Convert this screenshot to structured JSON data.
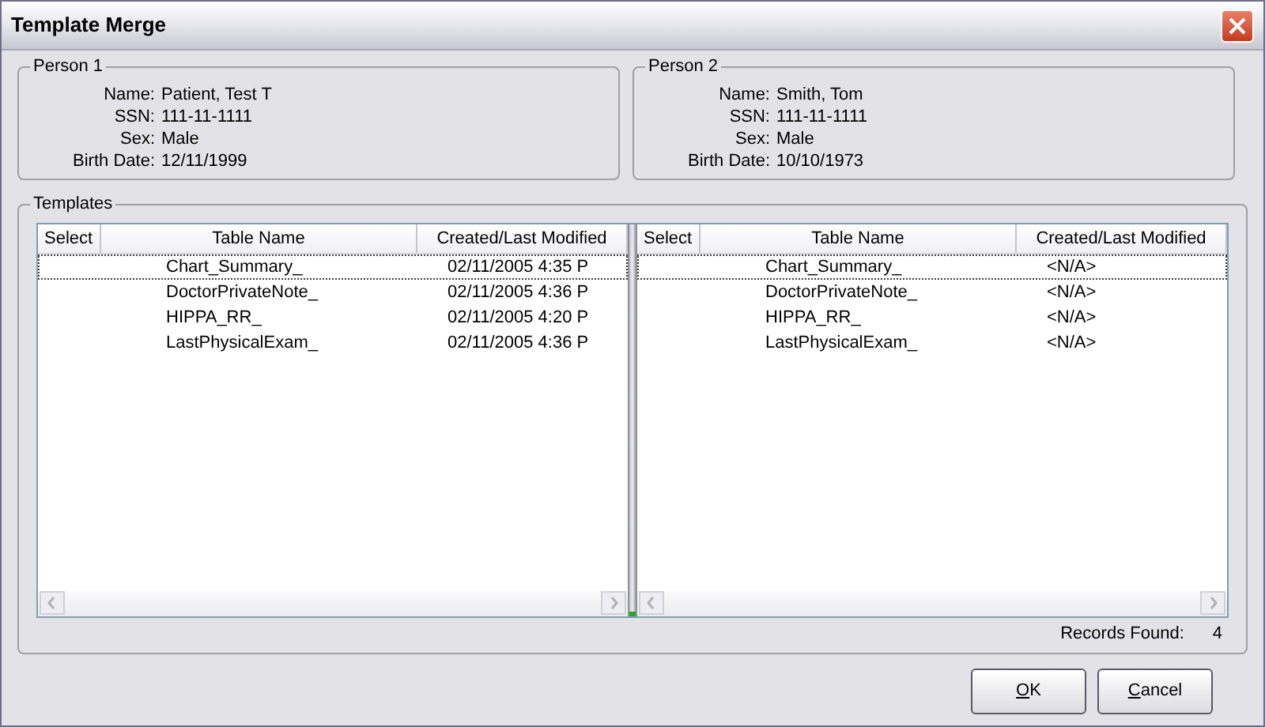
{
  "window": {
    "title": "Template Merge"
  },
  "persons": [
    {
      "title": "Person 1",
      "fields": [
        {
          "label": "Name:",
          "value": "Patient, Test T"
        },
        {
          "label": "SSN:",
          "value": "111-11-1111"
        },
        {
          "label": "Sex:",
          "value": "Male"
        },
        {
          "label": "Birth Date:",
          "value": "12/11/1999"
        }
      ]
    },
    {
      "title": "Person 2",
      "fields": [
        {
          "label": "Name:",
          "value": "Smith, Tom"
        },
        {
          "label": "SSN:",
          "value": "111-11-1111"
        },
        {
          "label": "Sex:",
          "value": "Male"
        },
        {
          "label": "Birth Date:",
          "value": "10/10/1973"
        }
      ]
    }
  ],
  "templates": {
    "title": "Templates",
    "tables": [
      {
        "columns": [
          "Select",
          "Table Name",
          "Created/Last Modified"
        ],
        "rows": [
          {
            "cells": [
              "",
              "Chart_Summary_",
              "02/11/2005 4:35 P"
            ],
            "focused": true
          },
          {
            "cells": [
              "",
              "DoctorPrivateNote_",
              "02/11/2005 4:36 P"
            ],
            "focused": false
          },
          {
            "cells": [
              "",
              "HIPPA_RR_",
              "02/11/2005 4:20 P"
            ],
            "focused": false
          },
          {
            "cells": [
              "",
              "LastPhysicalExam_",
              "02/11/2005 4:36 P"
            ],
            "focused": false
          }
        ]
      },
      {
        "columns": [
          "Select",
          "Table Name",
          "Created/Last Modified"
        ],
        "rows": [
          {
            "cells": [
              "",
              "Chart_Summary_",
              "<N/A>"
            ],
            "focused": true
          },
          {
            "cells": [
              "",
              "DoctorPrivateNote_",
              "<N/A>"
            ],
            "focused": false
          },
          {
            "cells": [
              "",
              "HIPPA_RR_",
              "<N/A>"
            ],
            "focused": false
          },
          {
            "cells": [
              "",
              "LastPhysicalExam_",
              "<N/A>"
            ],
            "focused": false
          }
        ]
      }
    ],
    "records_label": "Records Found:",
    "records_count": "4"
  },
  "buttons": [
    "OK",
    "Cancel"
  ]
}
